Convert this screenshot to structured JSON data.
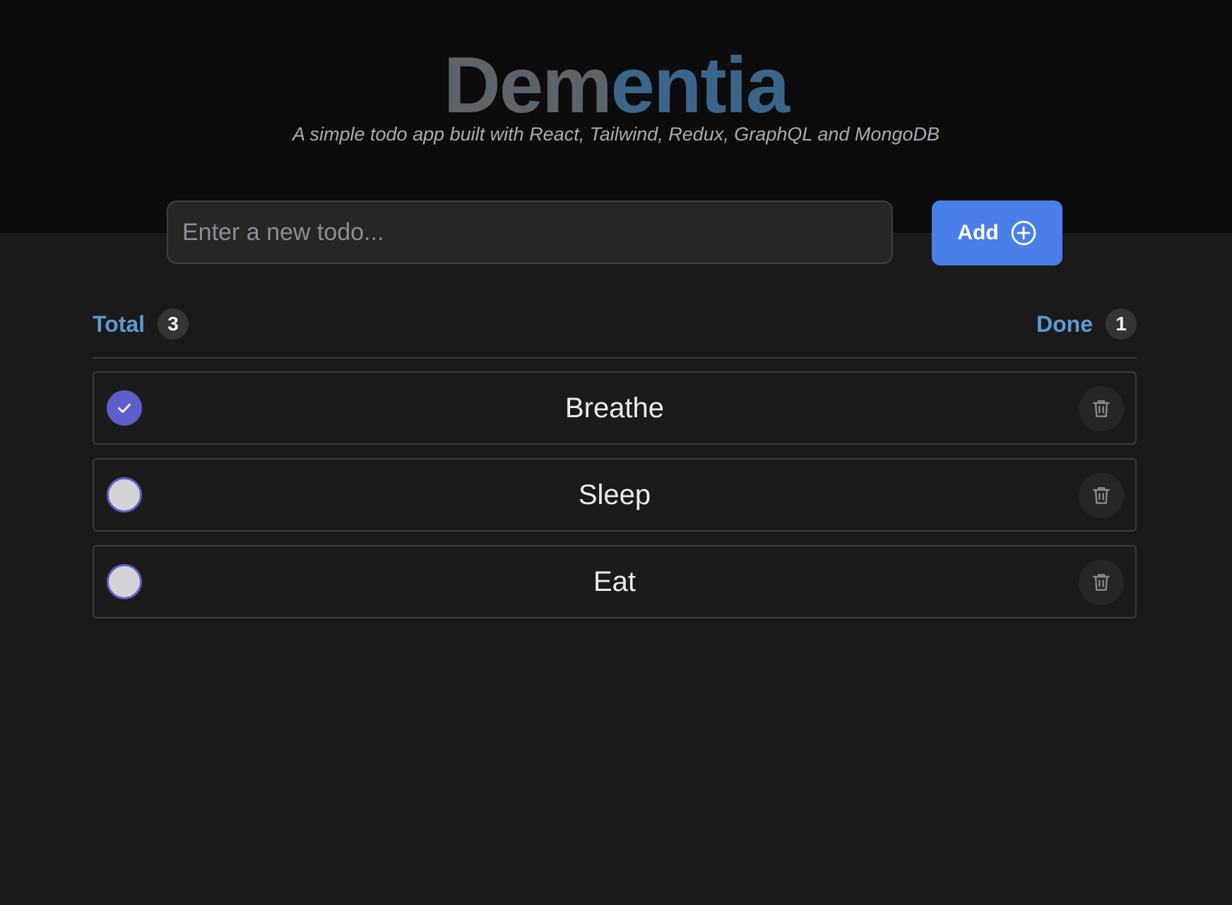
{
  "header": {
    "title_part1": "Dem",
    "title_part2": "entia",
    "subtitle": "A simple todo app built with React, Tailwind, Redux, GraphQL and MongoDB"
  },
  "new_todo": {
    "placeholder": "Enter a new todo...",
    "value": "",
    "add_label": "Add",
    "add_icon": "plus-circle-icon"
  },
  "stats": {
    "total_label": "Total",
    "total_count": "3",
    "done_label": "Done",
    "done_count": "1"
  },
  "todos": [
    {
      "text": "Breathe",
      "done": true,
      "delete_icon": "trash-icon"
    },
    {
      "text": "Sleep",
      "done": false,
      "delete_icon": "trash-icon"
    },
    {
      "text": "Eat",
      "done": false,
      "delete_icon": "trash-icon"
    }
  ],
  "colors": {
    "accent": "#4a7fe9",
    "checkbox": "#5d5ec9",
    "stat_label": "#5b9bd5",
    "title_gray": "#5d6469",
    "title_blue": "#3c6689"
  }
}
